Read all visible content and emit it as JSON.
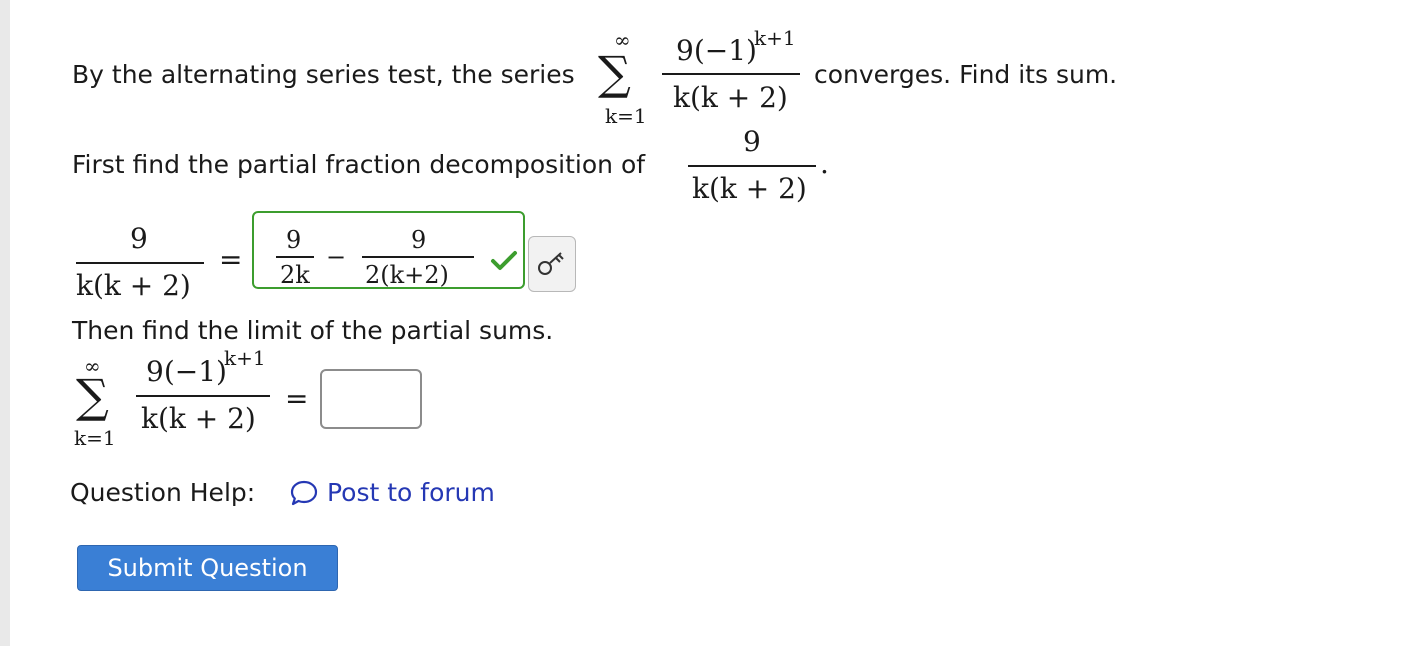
{
  "question": {
    "intro_text": "By the alternating series test, the series",
    "intro_tail": "converges. Find its sum.",
    "series": {
      "sum_lower": "k=1",
      "sum_upper": "∞",
      "numerator": "9(−1)",
      "numerator_exponent": "k+1",
      "denominator": "k(k + 2)"
    },
    "step1_text": "First find the partial fraction decomposition of",
    "step1_fraction": {
      "numerator": "9",
      "denominator": "k(k + 2)",
      "end_mark": "."
    },
    "decomposition": {
      "lhs_numerator": "9",
      "lhs_denominator": "k(k + 2)",
      "equals": "=",
      "answer": {
        "term1_numerator": "9",
        "term1_denominator": "2k",
        "minus": "−",
        "term2_numerator": "9",
        "term2_denominator": "2(k+2)"
      },
      "status": "correct"
    },
    "step2_text": "Then find the limit of the partial sums.",
    "limit": {
      "sum_lower": "k=1",
      "sum_upper": "∞",
      "numerator": "9(−1)",
      "numerator_exponent": "k+1",
      "denominator": "k(k + 2)",
      "equals": "=",
      "input_value": ""
    }
  },
  "help": {
    "label": "Question Help:",
    "forum_link": "Post to forum"
  },
  "submit_label": "Submit Question",
  "icons": {
    "correct": "check-icon",
    "key": "key-icon",
    "forum": "speech-bubble-icon"
  },
  "colors": {
    "correct_green": "#3c9d2e",
    "link_blue": "#2538b4",
    "submit_blue": "#3a7fd5"
  }
}
